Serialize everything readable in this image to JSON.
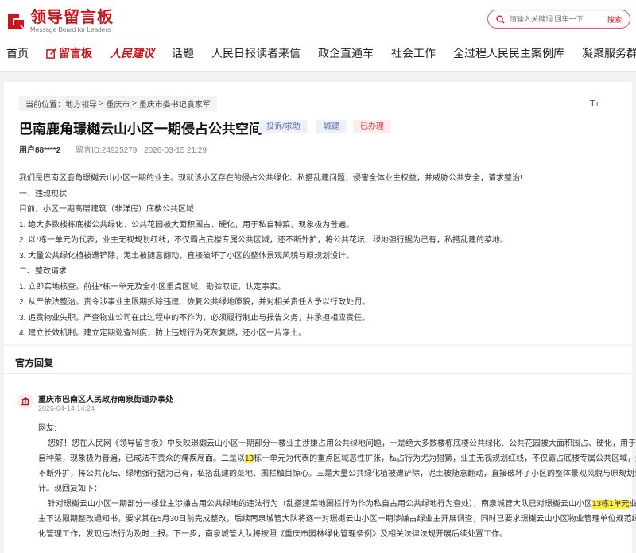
{
  "brand": {
    "title": "领导留言板",
    "subtitle": "Message Board for Leaders",
    "accent": "#c8161d"
  },
  "search": {
    "placeholder": "请输入关键词 回车一下",
    "button": "搜索"
  },
  "nav": {
    "items": [
      "首页",
      "留言板",
      "人民建议",
      "话题",
      "人民日报读者来信",
      "政企直通车",
      "社会工作",
      "全过程人民民主案例库",
      "凝聚服务群众"
    ]
  },
  "breadcrumb": {
    "prefix": "当前位置：",
    "items": [
      "地方领导",
      "重庆市",
      "重庆市委书记袁家军"
    ],
    "sep": " > "
  },
  "font_toggle": "TT",
  "message": {
    "title": "巴南鹿角璟樾云山小区一期侵占公共空间",
    "tags": [
      "投诉/求助",
      "城建",
      "已办理"
    ],
    "user": "用户88****2",
    "id": "留言ID:24925279",
    "time": "2026-03-15 21:29",
    "body": [
      "我们是巴南区鹿角璟樾云山小区一期的业主。现就该小区存在的侵占公共绿化、私搭乱建问题，侵害全体业主权益，并威胁公共安全，请求整治!",
      "一、违规现状",
      "目前，小区一期高层建筑（非洋房）底楼公共区域",
      " 1. 绝大多数楼栋底楼公共绿化、公共花园被大面积围占、硬化，用于私自种菜，现象极为普遍。",
      "2. 以*栋一单元为代表，业主无视规划红线，不仅霸占底楼专属公共区域，还不断外扩，将公共花坛、绿地强行据为己有，私搭乱建的菜地。",
      "3. 大量公共绿化植被遭铲除，泥土被随意翻动，直接破坏了小区的整体景观风貌与原规划设计。",
      "二、整改请求",
      "1. 立即实地核查。前往*栋一单元及全小区重点区域，勘验取证，认定事实。",
      "2. 从严依法整治。责令涉事业主限期拆除违建、恢复公共绿地原貌，并对相关责任人予以行政处罚。",
      "3. 追责物业失职。严查物业公司在此过程中的不作为，必须履行制止与报告义务，并承担相应责任。",
      "4. 建立长效机制。建立定期巡查制度，防止违规行为死灰复燃，还小区一片净土。"
    ]
  },
  "reply": {
    "section_title": "官方回复",
    "org": "重庆市巴南区人民政府南泉街道办事处",
    "time": "2026-04-14 14:24",
    "greeting": "网友:",
    "p1a": "您好！您在人民网《领导留言板》中反映璟樾云山小区一期部分一楼业主涉嫌占用公共绿地问题，一是绝大多数楼栋底楼公共绿化、公共花园被大面积围占、硬化，用于私",
    "p1b_pre": "自种菜，现象极为普遍，已成法不责众的痛疾局面。二是以",
    "p1b_hl": "13",
    "p1b_post": "栋一单元为代表的重点区域恶性扩张，私占行为尤为猖獗，业主无视规划红线，不仅霸占底楼专属公共区域，还",
    "p1c": "不断外扩，将公共花坛、绿地强行据为己有，私搭乱建的菜地、围栏触目惊心。三是大量公共绿化植被遭铲除，泥土被随意翻动，直接破坏了小区的整体景观风貌与原规划设",
    "p1d": "计。现回复如下：",
    "p2a_pre": "针对璟樾云山小区一期部分一楼业主涉嫌占用公共绿地的违法行为（乱搭建菜地围栏行为作为私自占用公共绿地行为查处），南泉城管大队已对璟樾云山小区",
    "p2a_hl": "13栋1单元",
    "p2a_post": "业",
    "p2b": "主下达限期整改通知书，要求其在5月30日前完成整改，后续南泉城管大队将逐一对璟樾云山小区一期涉嫌占绿业主开展调查，同时已要求璟樾云山小区物业管理单位规范绿",
    "p2c": "化管理工作，发现违法行为及时上报。下一步，南泉城管大队将按照《重庆市园林绿化管理条例》及相关法律法规开展后续处置工作。"
  }
}
